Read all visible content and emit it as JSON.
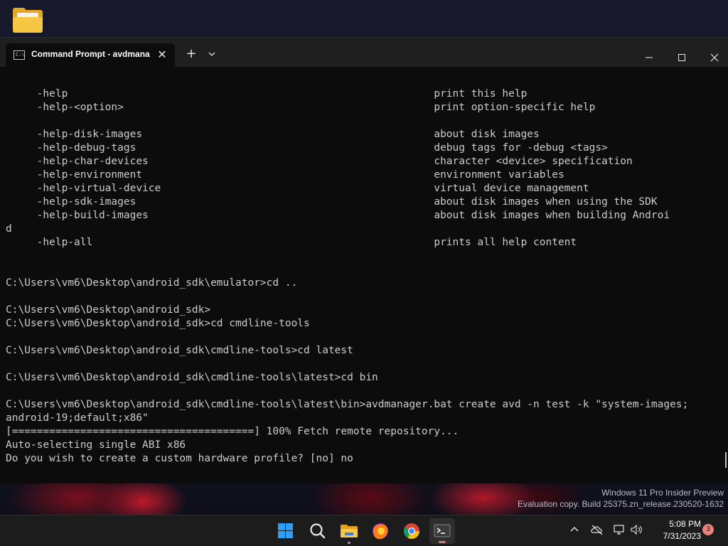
{
  "window": {
    "tab_title": "Command Prompt - avdmana",
    "tab_close": "✕",
    "new_tab": "+",
    "cmd_icon_text": "C:\\"
  },
  "console_lines": [
    "     -help                                                           print this help",
    "     -help-<option>                                                  print option-specific help",
    "",
    "     -help-disk-images                                               about disk images",
    "     -help-debug-tags                                                debug tags for -debug <tags>",
    "     -help-char-devices                                              character <device> specification",
    "     -help-environment                                               environment variables",
    "     -help-virtual-device                                            virtual device management",
    "     -help-sdk-images                                                about disk images when using the SDK",
    "     -help-build-images                                              about disk images when building Androi",
    "d",
    "     -help-all                                                       prints all help content",
    "",
    "",
    "C:\\Users\\vm6\\Desktop\\android_sdk\\emulator>cd ..",
    "",
    "C:\\Users\\vm6\\Desktop\\android_sdk>",
    "C:\\Users\\vm6\\Desktop\\android_sdk>cd cmdline-tools",
    "",
    "C:\\Users\\vm6\\Desktop\\android_sdk\\cmdline-tools>cd latest",
    "",
    "C:\\Users\\vm6\\Desktop\\android_sdk\\cmdline-tools\\latest>cd bin",
    "",
    "C:\\Users\\vm6\\Desktop\\android_sdk\\cmdline-tools\\latest\\bin>avdmanager.bat create avd -n test -k \"system-images;",
    "android-19;default;x86\"",
    "[=======================================] 100% Fetch remote repository...",
    "Auto-selecting single ABI x86",
    "Do you wish to create a custom hardware profile? [no] no"
  ],
  "watermark": {
    "line1": "Windows 11 Pro Insider Preview",
    "line2": "Evaluation copy. Build 25375.zn_release.230520-1632"
  },
  "taskbar": {
    "time": "5:08 PM",
    "date": "7/31/2023",
    "notification_count": "3",
    "apps": [
      "start-icon",
      "search-icon",
      "file-explorer-icon",
      "firefox-icon",
      "chrome-icon",
      "terminal-icon"
    ]
  },
  "colors": {
    "console_bg": "#0c0c0c",
    "console_text": "#cccccc",
    "titlebar_bg": "#1f1f1f",
    "taskbar_bg": "#1c1c1c",
    "folder_yellow": "#f6c745",
    "notification_badge": "#e8837a"
  }
}
